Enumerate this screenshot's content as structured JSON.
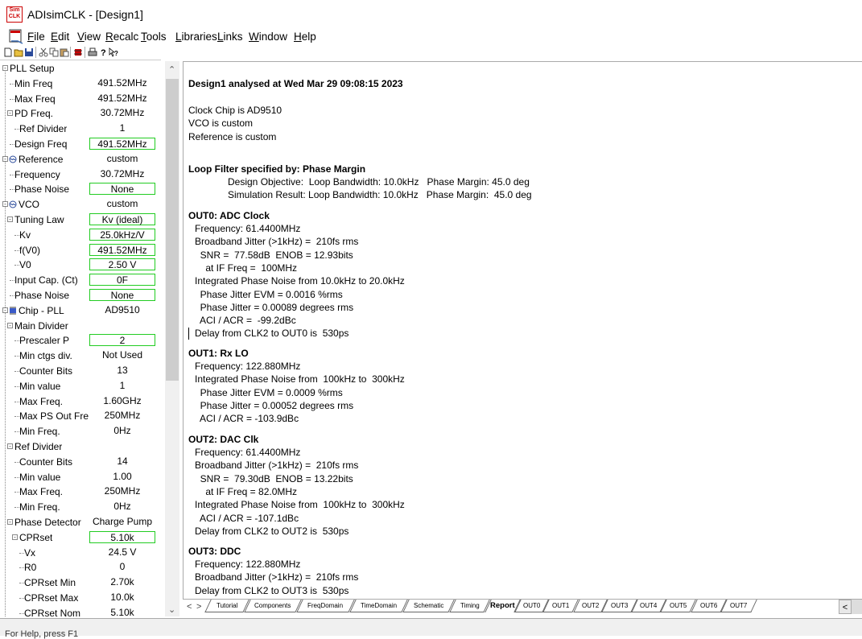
{
  "window": {
    "title": "ADIsimCLK - [Design1]",
    "app_icon_text": "Sim CLK"
  },
  "menu": [
    {
      "label": "File"
    },
    {
      "label": "Edit"
    },
    {
      "label": "View"
    },
    {
      "label": "Recalc"
    },
    {
      "label": "Tools"
    },
    {
      "label": "Libraries"
    },
    {
      "label": "Links"
    },
    {
      "label": "Window"
    },
    {
      "label": "Help"
    }
  ],
  "toolbar": [
    "new-icon",
    "open-icon",
    "save-icon",
    "cut-icon",
    "copy-icon",
    "paste-icon",
    "chip-icon",
    "print-icon",
    "help-icon",
    "context-help-icon"
  ],
  "tree": [
    {
      "label": "PLL Setup",
      "value": ""
    },
    {
      "label": "Min Freq",
      "value": "491.52MHz"
    },
    {
      "label": "Max Freq",
      "value": "491.52MHz"
    },
    {
      "label": "PD Freq.",
      "value": "30.72MHz"
    },
    {
      "label": "Ref Divider",
      "value": "1"
    },
    {
      "label": "Design Freq",
      "value": "491.52MHz"
    },
    {
      "label": "Reference",
      "value": "custom"
    },
    {
      "label": "Frequency",
      "value": "30.72MHz"
    },
    {
      "label": "Phase Noise",
      "value": "None"
    },
    {
      "label": "VCO",
      "value": "custom"
    },
    {
      "label": "Tuning Law",
      "value": "Kv (ideal)"
    },
    {
      "label": "Kv",
      "value": "25.0kHz/V"
    },
    {
      "label": "f(V0)",
      "value": "491.52MHz"
    },
    {
      "label": "V0",
      "value": "2.50 V"
    },
    {
      "label": "Input Cap. (Ct)",
      "value": "0F"
    },
    {
      "label": "Phase Noise",
      "value": "None"
    },
    {
      "label": "Chip - PLL",
      "value": "AD9510"
    },
    {
      "label": "Main Divider",
      "value": ""
    },
    {
      "label": "Prescaler P",
      "value": "2"
    },
    {
      "label": "Min ctgs div.",
      "value": "Not Used"
    },
    {
      "label": "Counter Bits",
      "value": "13"
    },
    {
      "label": "Min value",
      "value": "1"
    },
    {
      "label": "Max Freq.",
      "value": "1.60GHz"
    },
    {
      "label": "Max PS Out Freq",
      "value": "250MHz"
    },
    {
      "label": "Min Freq.",
      "value": "0Hz"
    },
    {
      "label": "Ref Divider",
      "value": ""
    },
    {
      "label": "Counter Bits",
      "value": "14"
    },
    {
      "label": "Min value",
      "value": "1.00"
    },
    {
      "label": "Max Freq.",
      "value": "250MHz"
    },
    {
      "label": "Min Freq.",
      "value": "0Hz"
    },
    {
      "label": "Phase Detector",
      "value": "Charge Pump"
    },
    {
      "label": "CPRset",
      "value": "5.10k"
    },
    {
      "label": "Vx",
      "value": "24.5 V"
    },
    {
      "label": "R0",
      "value": "0"
    },
    {
      "label": "CPRset Min",
      "value": "2.70k"
    },
    {
      "label": "CPRset Max",
      "value": "10.0k"
    },
    {
      "label": "CPRset Nom",
      "value": "5.10k"
    }
  ],
  "report": {
    "heading": "Design1 analysed at Wed Mar 29 09:08:15 2023",
    "clock_chip": "Clock Chip is AD9510",
    "vco": "VCO is custom",
    "reference": "Reference is custom",
    "loop_filter_title": "Loop Filter specified by: Phase Margin",
    "design_objective": "Design Objective:  Loop Bandwidth: 10.0kHz   Phase Margin: 45.0 deg",
    "simulation_result": "Simulation Result: Loop Bandwidth: 10.0kHz   Phase Margin:  45.0 deg",
    "outputs": [
      {
        "title": "OUT0: ADC Clock",
        "lines": [
          "Frequency: 61.4400MHz",
          "Broadband Jitter (>1kHz) =  210fs rms",
          "  SNR =  77.58dB  ENOB = 12.93bits",
          "    at IF Freq =  100MHz",
          "Integrated Phase Noise from 10.0kHz to 20.0kHz",
          "  Phase Jitter EVM = 0.0016 %rms",
          "  Phase Jitter = 0.00089 degrees rms",
          "  ACI / ACR =  -99.2dBc",
          "Delay from CLK2 to OUT0 is  530ps"
        ]
      },
      {
        "title": "OUT1: Rx LO",
        "lines": [
          "Frequency: 122.880MHz",
          "Integrated Phase Noise from  100kHz to  300kHz",
          "  Phase Jitter EVM = 0.0009 %rms",
          "  Phase Jitter = 0.00052 degrees rms",
          "  ACI / ACR = -103.9dBc"
        ]
      },
      {
        "title": "OUT2: DAC Clk",
        "lines": [
          "Frequency: 61.4400MHz",
          "Broadband Jitter (>1kHz) =  210fs rms",
          "  SNR =  79.30dB  ENOB = 13.22bits",
          "    at IF Freq = 82.0MHz",
          "Integrated Phase Noise from  100kHz to  300kHz",
          "  ACI / ACR = -107.1dBc",
          "Delay from CLK2 to OUT2 is  530ps"
        ]
      },
      {
        "title": "OUT3: DDC",
        "lines": [
          "Frequency: 122.880MHz",
          "Broadband Jitter (>1kHz) =  210fs rms",
          "Delay from CLK2 to OUT3 is  530ps"
        ]
      }
    ]
  },
  "tabs": [
    {
      "label": "Tutorial"
    },
    {
      "label": "Components"
    },
    {
      "label": "FreqDomain"
    },
    {
      "label": "TimeDomain"
    },
    {
      "label": "Schematic"
    },
    {
      "label": "Timing"
    },
    {
      "label": "Report",
      "active": true
    },
    {
      "label": "OUT0"
    },
    {
      "label": "OUT1"
    },
    {
      "label": "OUT2"
    },
    {
      "label": "OUT3"
    },
    {
      "label": "OUT4"
    },
    {
      "label": "OUT5"
    },
    {
      "label": "OUT6"
    },
    {
      "label": "OUT7"
    }
  ],
  "status": {
    "text": "For Help, press F1"
  },
  "colors": {
    "value_box_border": "#22cc22",
    "accent": "#c00000"
  }
}
